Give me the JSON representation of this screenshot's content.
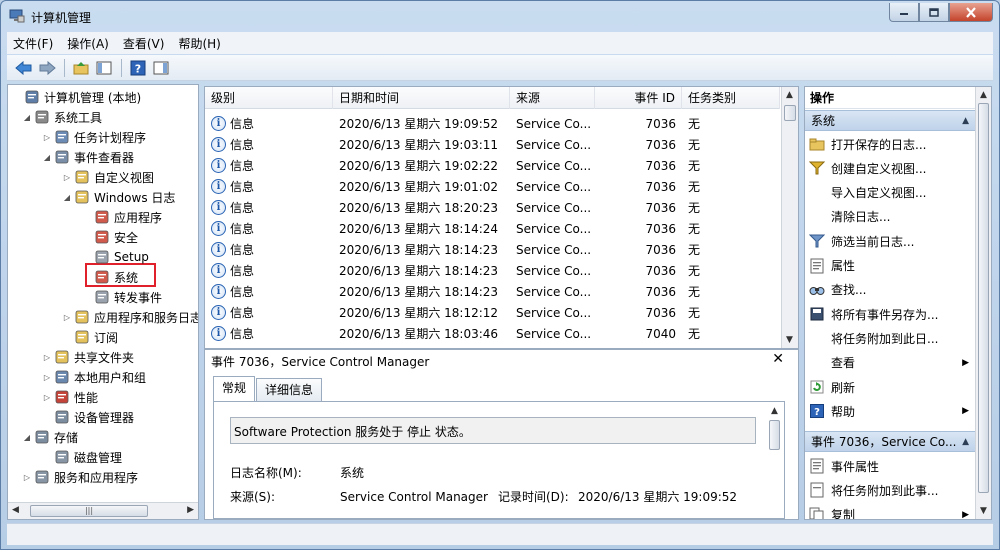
{
  "window": {
    "title": "计算机管理",
    "minimize_icon": "minimize-icon",
    "maximize_icon": "maximize-icon",
    "close_icon": "close-icon"
  },
  "menu": [
    "文件(F)",
    "操作(A)",
    "查看(V)",
    "帮助(H)"
  ],
  "toolbar": [
    "back-icon",
    "forward-icon",
    "up-folder-icon",
    "show-hide-tree-icon",
    "help-icon",
    "show-hide-action-pane-icon"
  ],
  "tree": [
    {
      "label": "计算机管理 (本地)",
      "level": 0,
      "toggle": "",
      "icon": "computer-icon",
      "color": "#5f7fa8"
    },
    {
      "label": "系统工具",
      "level": 1,
      "toggle": "◢",
      "icon": "tools-icon",
      "color": "#8a8a8a"
    },
    {
      "label": "任务计划程序",
      "level": 2,
      "toggle": "▷",
      "icon": "clock-icon",
      "color": "#6d8cb5"
    },
    {
      "label": "事件查看器",
      "level": 2,
      "toggle": "◢",
      "icon": "event-viewer-icon",
      "color": "#7a8fa7"
    },
    {
      "label": "自定义视图",
      "level": 3,
      "toggle": "▷",
      "icon": "folder-icon",
      "color": "#e3c15c"
    },
    {
      "label": "Windows 日志",
      "level": 3,
      "toggle": "◢",
      "icon": "folder-icon",
      "color": "#e3c15c"
    },
    {
      "label": "应用程序",
      "level": 4,
      "toggle": "",
      "icon": "log-icon",
      "color": "#d05a4c"
    },
    {
      "label": "安全",
      "level": 4,
      "toggle": "",
      "icon": "log-icon",
      "color": "#d05a4c"
    },
    {
      "label": "Setup",
      "level": 4,
      "toggle": "",
      "icon": "log-icon",
      "color": "#9aa3ad"
    },
    {
      "label": "系统",
      "level": 4,
      "toggle": "",
      "icon": "log-icon",
      "color": "#d05a4c"
    },
    {
      "label": "转发事件",
      "level": 4,
      "toggle": "",
      "icon": "log-icon",
      "color": "#9aa3ad"
    },
    {
      "label": "应用程序和服务日志",
      "level": 3,
      "toggle": "▷",
      "icon": "folder-icon",
      "color": "#e3c15c"
    },
    {
      "label": "订阅",
      "level": 3,
      "toggle": "",
      "icon": "subscription-icon",
      "color": "#e3c15c"
    },
    {
      "label": "共享文件夹",
      "level": 2,
      "toggle": "▷",
      "icon": "shared-folder-icon",
      "color": "#e3c15c"
    },
    {
      "label": "本地用户和组",
      "level": 2,
      "toggle": "▷",
      "icon": "users-icon",
      "color": "#6a87ad"
    },
    {
      "label": "性能",
      "level": 2,
      "toggle": "▷",
      "icon": "performance-icon",
      "color": "#c4443a"
    },
    {
      "label": "设备管理器",
      "level": 2,
      "toggle": "",
      "icon": "device-manager-icon",
      "color": "#7d8da0"
    },
    {
      "label": "存储",
      "level": 1,
      "toggle": "◢",
      "icon": "storage-icon",
      "color": "#7d8da0"
    },
    {
      "label": "磁盘管理",
      "level": 2,
      "toggle": "",
      "icon": "disk-icon",
      "color": "#8895a5"
    },
    {
      "label": "服务和应用程序",
      "level": 1,
      "toggle": "▷",
      "icon": "services-icon",
      "color": "#8895a5"
    }
  ],
  "columns": [
    "级别",
    "日期和时间",
    "来源",
    "事件 ID",
    "任务类别"
  ],
  "events": [
    {
      "level": "信息",
      "datetime": "2020/6/13 星期六 19:09:52",
      "source": "Service Co...",
      "id": "7036",
      "category": "无"
    },
    {
      "level": "信息",
      "datetime": "2020/6/13 星期六 19:03:11",
      "source": "Service Co...",
      "id": "7036",
      "category": "无"
    },
    {
      "level": "信息",
      "datetime": "2020/6/13 星期六 19:02:22",
      "source": "Service Co...",
      "id": "7036",
      "category": "无"
    },
    {
      "level": "信息",
      "datetime": "2020/6/13 星期六 19:01:02",
      "source": "Service Co...",
      "id": "7036",
      "category": "无"
    },
    {
      "level": "信息",
      "datetime": "2020/6/13 星期六 18:20:23",
      "source": "Service Co...",
      "id": "7036",
      "category": "无"
    },
    {
      "level": "信息",
      "datetime": "2020/6/13 星期六 18:14:24",
      "source": "Service Co...",
      "id": "7036",
      "category": "无"
    },
    {
      "level": "信息",
      "datetime": "2020/6/13 星期六 18:14:23",
      "source": "Service Co...",
      "id": "7036",
      "category": "无"
    },
    {
      "level": "信息",
      "datetime": "2020/6/13 星期六 18:14:23",
      "source": "Service Co...",
      "id": "7036",
      "category": "无"
    },
    {
      "level": "信息",
      "datetime": "2020/6/13 星期六 18:14:23",
      "source": "Service Co...",
      "id": "7036",
      "category": "无"
    },
    {
      "level": "信息",
      "datetime": "2020/6/13 星期六 18:12:12",
      "source": "Service Co...",
      "id": "7036",
      "category": "无"
    },
    {
      "level": "信息",
      "datetime": "2020/6/13 星期六 18:03:46",
      "source": "Service Co...",
      "id": "7040",
      "category": "无"
    }
  ],
  "detail": {
    "title": "事件 7036，Service Control Manager",
    "tabs": [
      "常规",
      "详细信息"
    ],
    "description": "Software Protection 服务处于 停止 状态。",
    "log_name_label": "日志名称(M):",
    "log_name_value": "系统",
    "source_label": "来源(S):",
    "source_value": "Service Control Manager",
    "logged_label": "记录时间(D):",
    "logged_value": "2020/6/13 星期六 19:09:52"
  },
  "actions": {
    "title": "操作",
    "section1": "系统",
    "section1_items": [
      {
        "label": "打开保存的日志...",
        "icon": "open-log-icon",
        "arrow": false
      },
      {
        "label": "创建自定义视图...",
        "icon": "filter-create-icon",
        "arrow": false
      },
      {
        "label": "导入自定义视图...",
        "icon": "blank",
        "arrow": false
      },
      {
        "label": "清除日志...",
        "icon": "blank",
        "arrow": false
      },
      {
        "label": "筛选当前日志...",
        "icon": "filter-icon",
        "arrow": false
      },
      {
        "label": "属性",
        "icon": "properties-icon",
        "arrow": false
      },
      {
        "label": "查找...",
        "icon": "find-icon",
        "arrow": false
      },
      {
        "label": "将所有事件另存为...",
        "icon": "save-icon",
        "arrow": false
      },
      {
        "label": "将任务附加到此日...",
        "icon": "blank",
        "arrow": false
      },
      {
        "label": "查看",
        "icon": "blank",
        "arrow": true
      },
      {
        "label": "刷新",
        "icon": "refresh-icon",
        "arrow": false
      },
      {
        "label": "帮助",
        "icon": "help-icon",
        "arrow": true
      }
    ],
    "section2": "事件 7036，Service Co...",
    "section2_items": [
      {
        "label": "事件属性",
        "icon": "properties-icon",
        "arrow": false
      },
      {
        "label": "将任务附加到此事...",
        "icon": "task-icon",
        "arrow": false
      },
      {
        "label": "复制",
        "icon": "copy-icon",
        "arrow": true
      }
    ]
  }
}
